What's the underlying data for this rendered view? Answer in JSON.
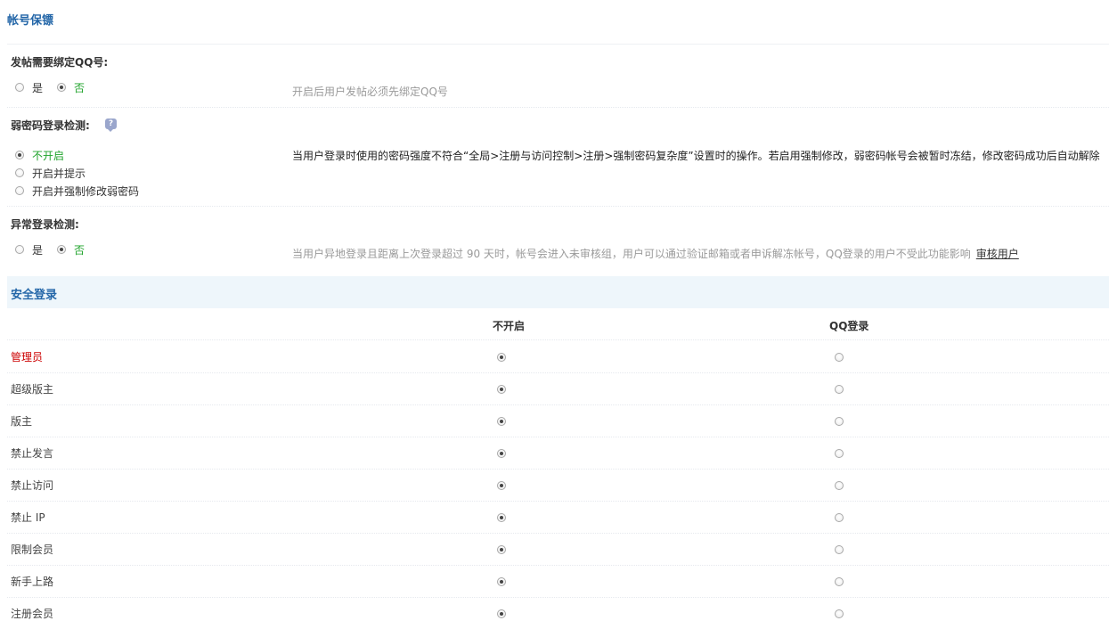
{
  "page_title": "帐号保镖",
  "settings": [
    {
      "title": "发帖需要绑定QQ号:",
      "options": [
        {
          "label": "是",
          "checked": false
        },
        {
          "label": "否",
          "checked": true
        }
      ],
      "description": "开启后用户发帖必须先绑定QQ号"
    },
    {
      "title": "弱密码登录检测:",
      "help_icon": "help-bubble-icon",
      "options": [
        {
          "label": "不开启",
          "checked": true
        },
        {
          "label": "开启并提示",
          "checked": false
        },
        {
          "label": "开启并强制修改弱密码",
          "checked": false
        }
      ],
      "description": "当用户登录时使用的密码强度不符合“全局>注册与访问控制>注册>强制密码复杂度”设置时的操作。若启用强制修改，弱密码帐号会被暂时冻结，修改密码成功后自动解除"
    },
    {
      "title": "异常登录检测:",
      "options": [
        {
          "label": "是",
          "checked": false
        },
        {
          "label": "否",
          "checked": true
        }
      ],
      "description": "当用户异地登录且距离上次登录超过 90 天时，帐号会进入未审核组，用户可以通过验证邮箱或者申诉解冻帐号，QQ登录的用户不受此功能影响",
      "link": "审核用户"
    }
  ],
  "secure_login": {
    "title": "安全登录",
    "columns": [
      "不开启",
      "QQ登录"
    ],
    "rows": [
      {
        "label": "管理员",
        "selected": 0
      },
      {
        "label": "超级版主",
        "selected": 0
      },
      {
        "label": "版主",
        "selected": 0
      },
      {
        "label": "禁止发言",
        "selected": 0
      },
      {
        "label": "禁止访问",
        "selected": 0
      },
      {
        "label": "禁止 IP",
        "selected": 0
      },
      {
        "label": "限制会员",
        "selected": 0
      },
      {
        "label": "新手上路",
        "selected": 0
      },
      {
        "label": "注册会员",
        "selected": 0
      }
    ]
  },
  "colors": {
    "title_blue": "#2366a8",
    "on_green": "#1fa32b",
    "admin_red": "#cc0000",
    "section_bg": "#eef6fb"
  }
}
